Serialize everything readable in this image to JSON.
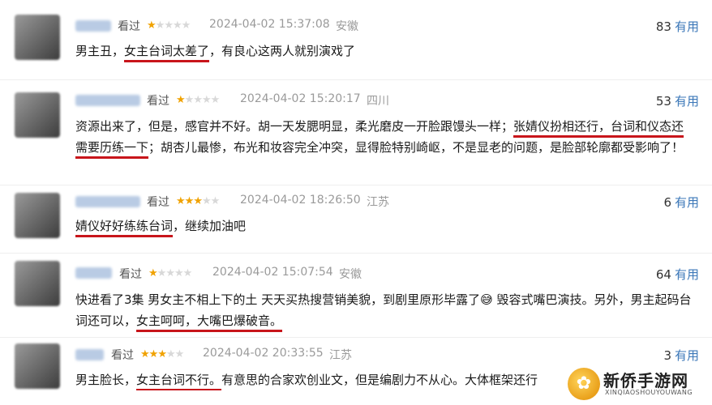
{
  "rated_label": "看过",
  "useful_label": "有用",
  "reviews": [
    {
      "rating": 1,
      "datetime": "2024-04-02 15:37:08",
      "location": "安徽",
      "useful_count": "83",
      "text": [
        {
          "t": "男主丑，",
          "hl": false
        },
        {
          "t": "女主台词太差了",
          "hl": true
        },
        {
          "t": "，有良心这两人就别演戏了",
          "hl": false
        }
      ]
    },
    {
      "rating": 1,
      "datetime": "2024-04-02 15:20:17",
      "location": "四川",
      "useful_count": "53",
      "text": [
        {
          "t": "资源出来了，但是，感官并不好。胡一天发腮明显，柔光磨皮一开脸跟馒头一样；",
          "hl": false
        },
        {
          "t": "张婧仪扮相还行，台词和仪态还需要历练一下",
          "hl": true
        },
        {
          "t": "；胡杏儿最惨，布光和妆容完全冲突，显得脸特别崎岖，不是显老的问题，是脸部轮廓都受影响了！",
          "hl": false
        }
      ]
    },
    {
      "rating": 3,
      "datetime": "2024-04-02 18:26:50",
      "location": "江苏",
      "useful_count": "6",
      "text": [
        {
          "t": "婧仪好好练练台词",
          "hl": true
        },
        {
          "t": "，继续加油吧",
          "hl": false
        }
      ]
    },
    {
      "rating": 1,
      "datetime": "2024-04-02 15:07:54",
      "location": "安徽",
      "useful_count": "64",
      "text": [
        {
          "t": "快进看了3集 男女主不相上下的土 天天买热搜营销美貌，到剧里原形毕露了😅 毁容式嘴巴演技。另外，男主起码台词还可以，",
          "hl": false
        },
        {
          "t": "女主呵呵，大嘴巴爆破音。",
          "hl": true
        }
      ]
    },
    {
      "rating": 3,
      "datetime": "2024-04-02 20:33:55",
      "location": "江苏",
      "useful_count": "3",
      "text": [
        {
          "t": "男主脸长，",
          "hl": false
        },
        {
          "t": "女主台词不行。",
          "hl": true
        },
        {
          "t": "有意思的合家欢创业文，但是编剧力不从心。大体框架还行",
          "hl": false
        }
      ]
    }
  ],
  "watermark": {
    "logo_glyph": "✿",
    "title": "新侨手游网",
    "subtitle": "XINQIAOSHOUYOUWANG"
  }
}
